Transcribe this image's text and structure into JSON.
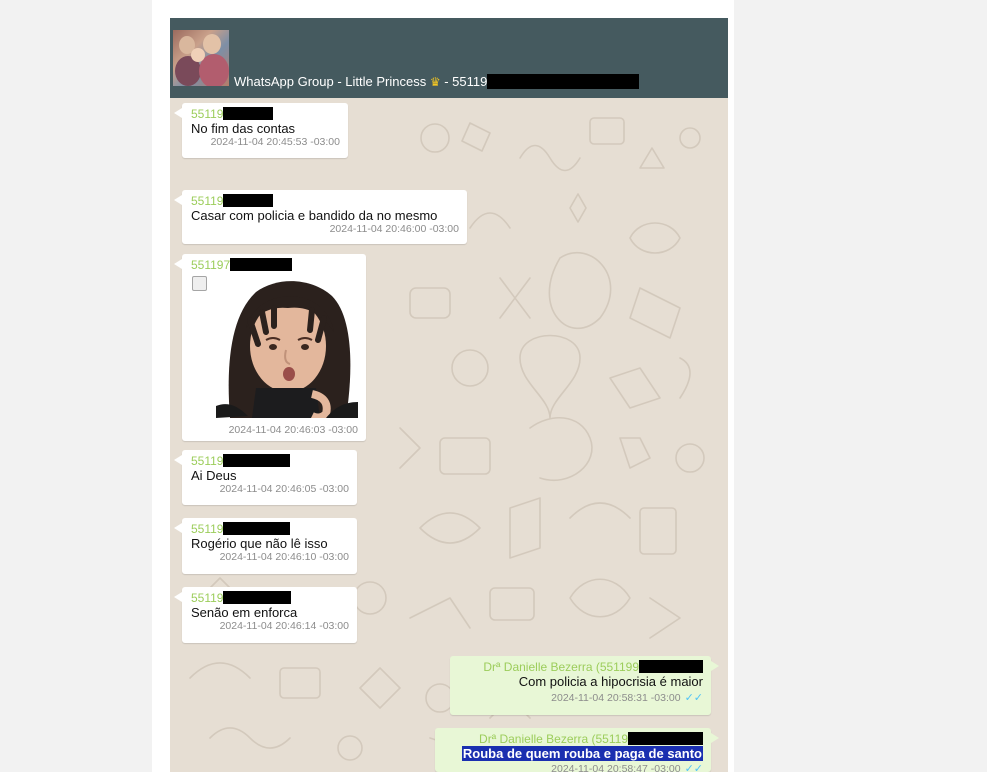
{
  "header": {
    "title": "WhatsApp Group - Little Princess",
    "crown_icon": "crown-icon",
    "number_prefix": " - 55119"
  },
  "messages": [
    {
      "sender": "55119",
      "text": "No fim das contas",
      "time": "2024-11-04 20:45:53 -03:00"
    },
    {
      "sender": "55119",
      "text": "Casar com policia e bandido da no mesmo",
      "time": "2024-11-04 20:46:00 -03:00"
    },
    {
      "sender": "551197",
      "type": "sticker",
      "time": "2024-11-04 20:46:03 -03:00"
    },
    {
      "sender": "55119",
      "text": "Ai Deus",
      "time": "2024-11-04 20:46:05 -03:00"
    },
    {
      "sender": "55119",
      "text": "Rogério que não lê isso",
      "time": "2024-11-04 20:46:10 -03:00"
    },
    {
      "sender": "55119",
      "text": "Senão em enforca",
      "time": "2024-11-04 20:46:14 -03:00"
    },
    {
      "sender": "Drª Danielle Bezerra (551199",
      "text": "Com policia a hipocrisia é maior",
      "time": "2024-11-04 20:58:31 -03:00",
      "status": "read"
    },
    {
      "sender": "Drª Danielle Bezerra (55119",
      "text": "Rouba de quem rouba e paga de santo",
      "time": "2024-11-04 20:58:47 -03:00",
      "status": "read",
      "highlighted": true
    }
  ],
  "read_ticks": "✓✓",
  "colors": {
    "header": "#455a5f",
    "sender": "#9ccd5b",
    "outgoing_bubble": "#e8f7d6",
    "highlight": "#1a2fb0",
    "read_ticks": "#4fc3f7"
  }
}
